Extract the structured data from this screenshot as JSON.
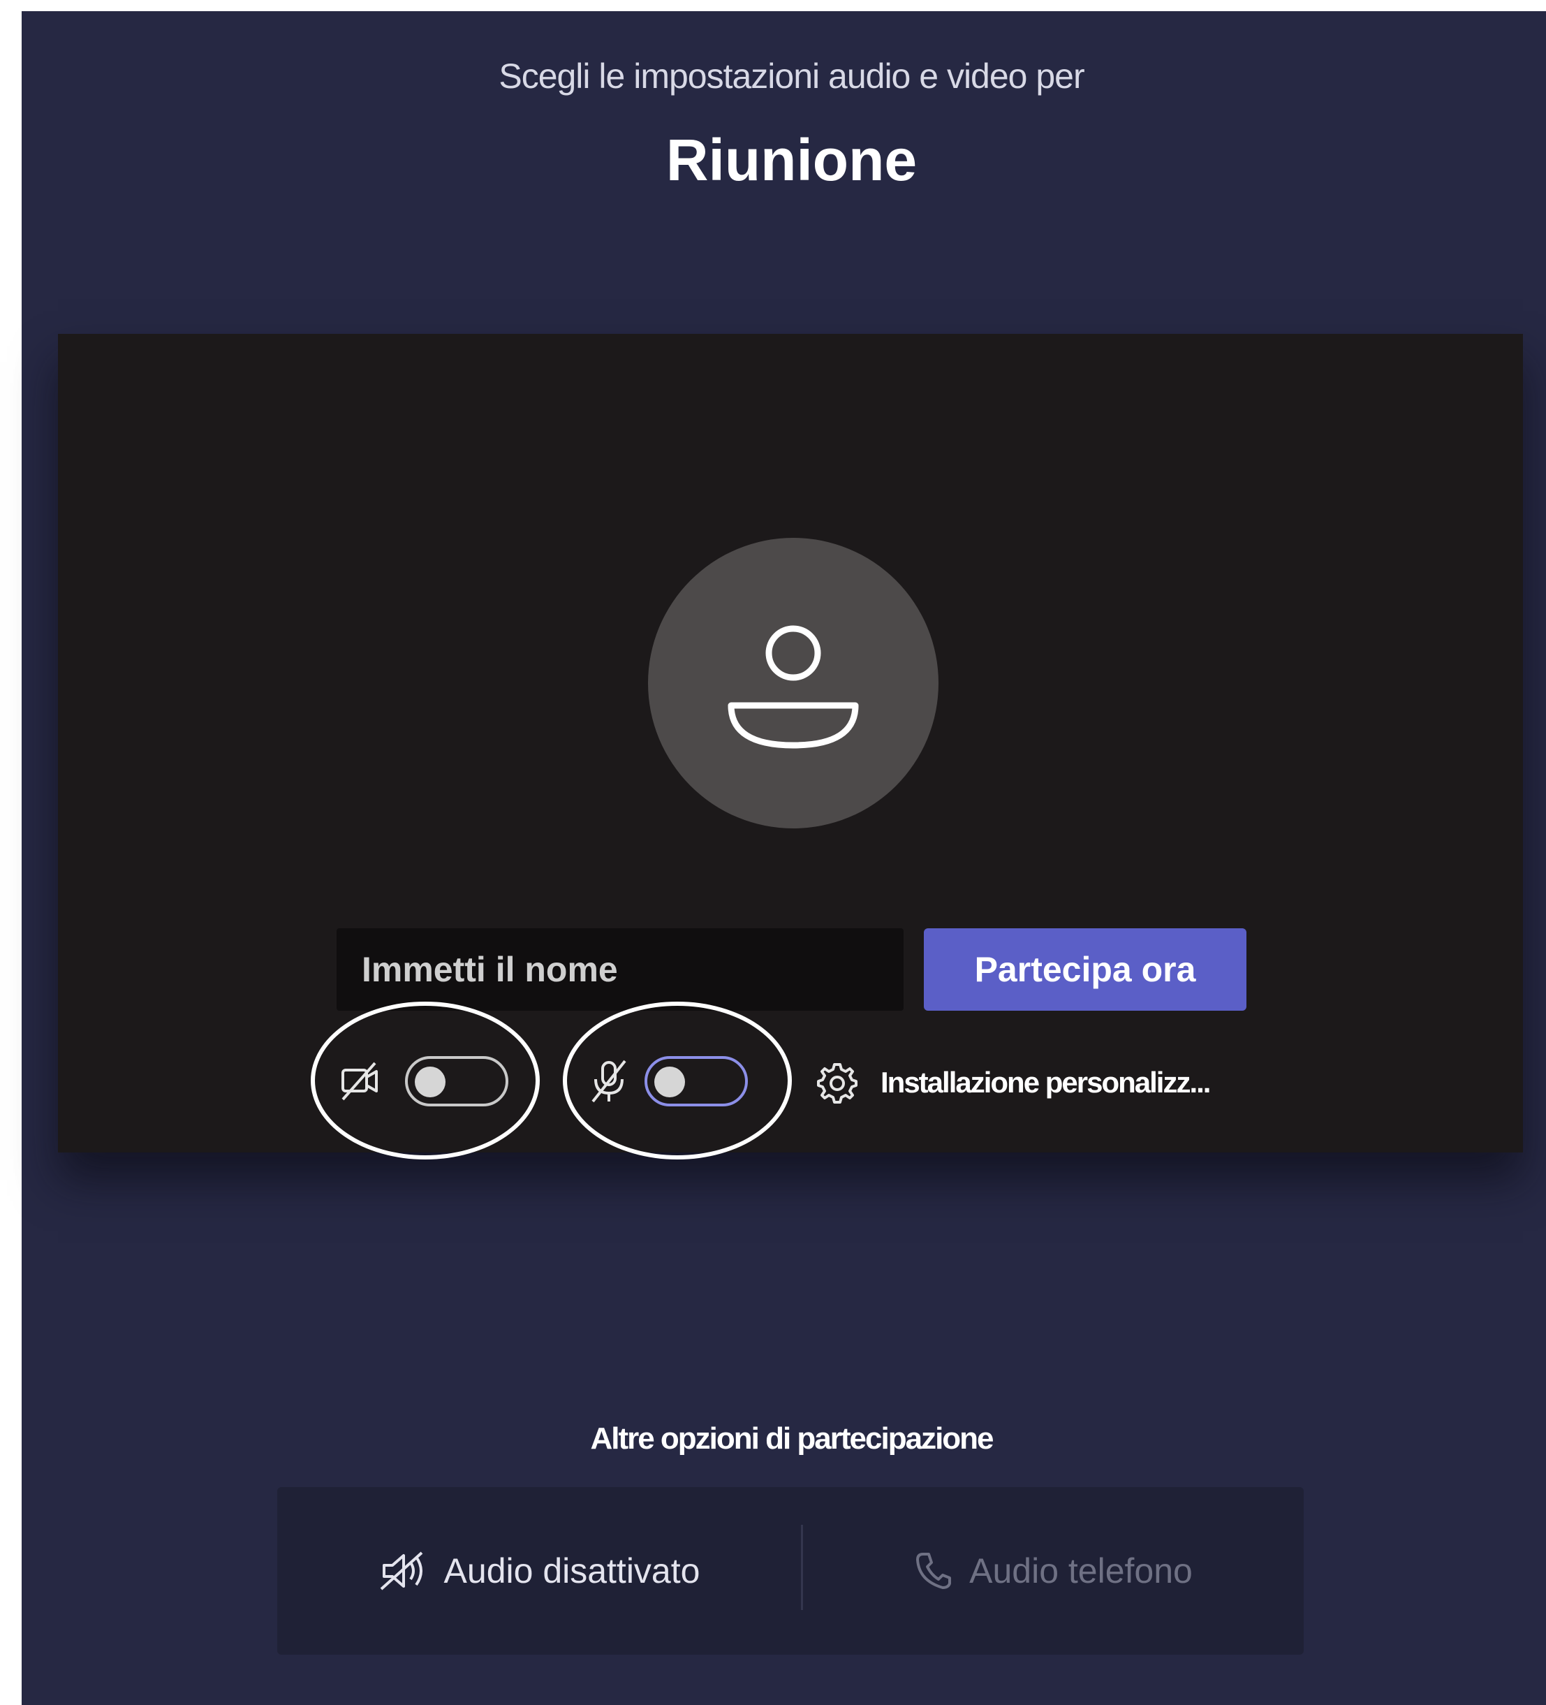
{
  "header": {
    "subtitle": "Scegli le impostazioni audio e video per",
    "title": "Riunione"
  },
  "preview": {
    "name_placeholder": "Immetti il nome",
    "join_label": "Partecipa ora",
    "camera_toggle_on": false,
    "mic_toggle_on": false,
    "setup_label": "Installazione personalizz..."
  },
  "other_options": {
    "label": "Altre opzioni di partecipazione",
    "audio_off_label": "Audio disattivato",
    "phone_audio_label": "Audio telefono"
  },
  "colors": {
    "background": "#262843",
    "preview_bg": "#1c191a",
    "accent": "#5b5fc7"
  }
}
